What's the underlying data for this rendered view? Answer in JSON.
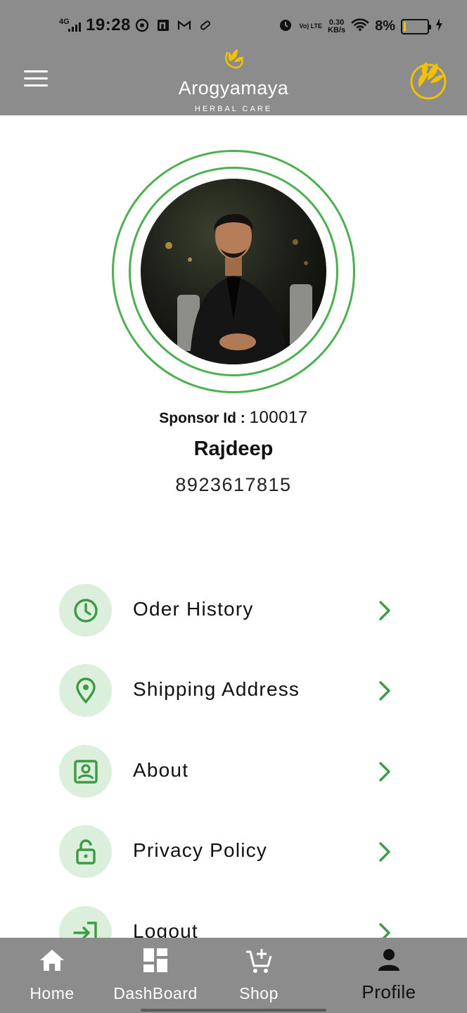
{
  "status_bar": {
    "network": "4G",
    "time": "19:28",
    "net_type": "Vo) LTE",
    "net_speed_value": "0.30",
    "net_speed_unit": "KB/s",
    "battery_percent": "8%",
    "battery_level": 0.08
  },
  "app_bar": {
    "brand_name": "Arogyamaya",
    "brand_subtitle": "HERBAL CARE"
  },
  "profile": {
    "sponsor_label": "Sponsor Id : ",
    "sponsor_id": "100017",
    "name": "Rajdeep",
    "phone": "8923617815"
  },
  "menu": {
    "items": [
      {
        "label": "Oder History",
        "icon": "clock-icon"
      },
      {
        "label": "Shipping Address",
        "icon": "location-pin-icon"
      },
      {
        "label": "About",
        "icon": "contact-card-icon"
      },
      {
        "label": "Privacy Policy",
        "icon": "lock-icon"
      },
      {
        "label": "Logout",
        "icon": "logout-icon"
      }
    ]
  },
  "bottom_nav": {
    "items": [
      {
        "label": "Home",
        "icon": "home-icon"
      },
      {
        "label": "DashBoard",
        "icon": "dashboard-icon"
      },
      {
        "label": "Shop",
        "icon": "cart-add-icon"
      },
      {
        "label": "Profile",
        "icon": "person-icon",
        "active": true
      }
    ]
  },
  "colors": {
    "bar_gray": "#8c8c8c",
    "accent_green": "#4caf50",
    "icon_bg": "#dcefdc",
    "logo_gold": "#f2c200"
  }
}
